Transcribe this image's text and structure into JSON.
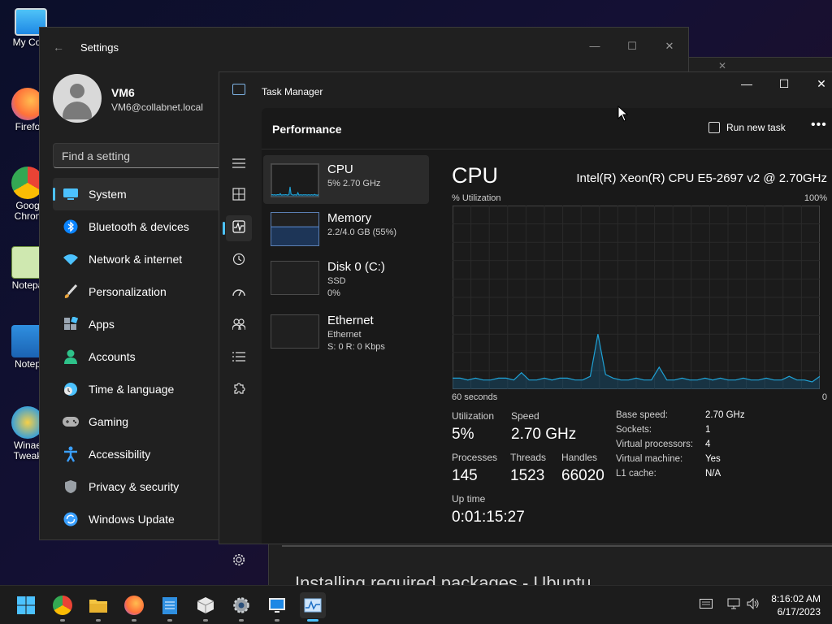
{
  "desktop": {
    "icons": [
      {
        "label": "My Com",
        "icon": "monitor-icon"
      },
      {
        "label": "Firefo",
        "icon": "firefox-icon"
      },
      {
        "label": "Goog Chron",
        "icon": "chrome-icon"
      },
      {
        "label": "Notepa",
        "icon": "notepad-plus-icon"
      },
      {
        "label": "Notep",
        "icon": "notepad-icon"
      },
      {
        "label": "Winae Tweak",
        "icon": "winaero-icon"
      }
    ]
  },
  "background_browser": {
    "heading": "Installing required packages - Ubuntu"
  },
  "settings": {
    "title": "Settings",
    "user": {
      "name": "VM6",
      "email": "VM6@collabnet.local"
    },
    "search_placeholder": "Find a setting",
    "nav": [
      {
        "label": "System",
        "icon": "system-icon",
        "color": "#4cc2ff",
        "active": true
      },
      {
        "label": "Bluetooth & devices",
        "icon": "bluetooth-icon",
        "color": "#0a84ff"
      },
      {
        "label": "Network & internet",
        "icon": "wifi-icon",
        "color": "#4cc2ff"
      },
      {
        "label": "Personalization",
        "icon": "brush-icon",
        "color": "#e8a33d"
      },
      {
        "label": "Apps",
        "icon": "apps-icon",
        "color": "#9aa6b2"
      },
      {
        "label": "Accounts",
        "icon": "accounts-icon",
        "color": "#2ec28a"
      },
      {
        "label": "Time & language",
        "icon": "clock-globe-icon",
        "color": "#4cc2ff"
      },
      {
        "label": "Gaming",
        "icon": "gamepad-icon",
        "color": "#b0b0b0"
      },
      {
        "label": "Accessibility",
        "icon": "accessibility-icon",
        "color": "#3aa0ff"
      },
      {
        "label": "Privacy & security",
        "icon": "shield-icon",
        "color": "#9aa0a6"
      },
      {
        "label": "Windows Update",
        "icon": "update-icon",
        "color": "#3aa0ff"
      }
    ]
  },
  "task_manager": {
    "title": "Task Manager",
    "section_title": "Performance",
    "run_new_task": "Run new task",
    "resources": [
      {
        "name": "CPU",
        "sub1": "5%  2.70 GHz",
        "sub2": "",
        "active": true
      },
      {
        "name": "Memory",
        "sub1": "2.2/4.0 GB (55%)",
        "sub2": ""
      },
      {
        "name": "Disk 0 (C:)",
        "sub1": "SSD",
        "sub2": "0%"
      },
      {
        "name": "Ethernet",
        "sub1": "Ethernet",
        "sub2": "S: 0 R: 0 Kbps"
      }
    ],
    "cpu": {
      "title": "CPU",
      "model": "Intel(R) Xeon(R) CPU E5-2697 v2 @ 2.70GHz",
      "util_label": "% Utilization",
      "util_max": "100%",
      "time_label": "60 seconds",
      "time_end": "0",
      "stats": {
        "utilization_label": "Utilization",
        "utilization": "5%",
        "speed_label": "Speed",
        "speed": "2.70 GHz",
        "processes_label": "Processes",
        "processes": "145",
        "threads_label": "Threads",
        "threads": "1523",
        "handles_label": "Handles",
        "handles": "66020",
        "uptime_label": "Up time",
        "uptime": "0:01:15:27"
      },
      "specs": [
        {
          "k": "Base speed:",
          "v": "2.70 GHz"
        },
        {
          "k": "Sockets:",
          "v": "1"
        },
        {
          "k": "Virtual processors:",
          "v": "4"
        },
        {
          "k": "Virtual machine:",
          "v": "Yes"
        },
        {
          "k": "L1 cache:",
          "v": "N/A"
        }
      ],
      "history_percent": [
        6,
        6,
        5,
        6,
        5,
        5,
        6,
        6,
        5,
        9,
        5,
        5,
        6,
        5,
        6,
        6,
        5,
        5,
        7,
        30,
        8,
        6,
        5,
        5,
        6,
        5,
        5,
        12,
        5,
        5,
        6,
        5,
        5,
        6,
        5,
        6,
        5,
        5,
        6,
        5,
        5,
        6,
        5,
        5,
        7,
        5,
        5,
        4,
        7
      ]
    }
  },
  "taskbar": {
    "apps": [
      {
        "icon": "windows-start-icon"
      },
      {
        "icon": "chrome-icon",
        "open": true
      },
      {
        "icon": "file-explorer-icon",
        "open": true
      },
      {
        "icon": "firefox-icon",
        "open": true
      },
      {
        "icon": "notepad-icon",
        "open": true
      },
      {
        "icon": "package-icon",
        "open": true
      },
      {
        "icon": "settings-gear-icon",
        "open": true
      },
      {
        "icon": "remote-desktop-icon",
        "open": true
      },
      {
        "icon": "task-manager-icon",
        "open": true,
        "active": true
      }
    ],
    "time": "8:16:02 AM",
    "date": "6/17/2023"
  }
}
